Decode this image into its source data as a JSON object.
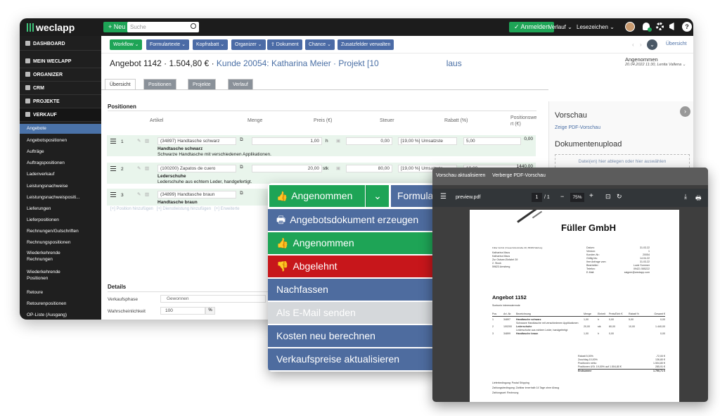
{
  "topbar": {
    "brand": "weclapp",
    "new_label": "+ Neu",
    "search_placeholder": "Suche",
    "login_label": "✓ Anmelden",
    "history_label": "Verlauf ⌄",
    "bookmarks_label": "Lesezeichen ⌄",
    "help_label": "?"
  },
  "sidebar": {
    "sections": [
      {
        "label": "DASHBOARD"
      },
      {
        "label": "MEIN WECLAPP"
      },
      {
        "label": "ORGANIZER"
      },
      {
        "label": "CRM"
      },
      {
        "label": "PROJEKTE"
      },
      {
        "label": "VERKAUF"
      }
    ],
    "items": [
      {
        "label": "Angebote"
      },
      {
        "label": "Angebotspositionen"
      },
      {
        "label": "Aufträge"
      },
      {
        "label": "Auftragspositionen"
      },
      {
        "label": "Ladenverkauf"
      },
      {
        "label": "Leistungsnachweise"
      },
      {
        "label": "Leistungsnachweispositi..."
      },
      {
        "label": "Lieferungen"
      },
      {
        "label": "Lieferpositionen"
      },
      {
        "label": "Rechnungen/Gutschriften"
      },
      {
        "label": "Rechnungspositionen"
      },
      {
        "label": "Wiederkehrende"
      },
      {
        "label": "Rechnungen"
      },
      {
        "label": "Wiederkehrende"
      },
      {
        "label": "Positionen"
      },
      {
        "label": "Retoure"
      },
      {
        "label": "Retourenpositionen"
      },
      {
        "label": "OP-Liste (Ausgang)"
      }
    ]
  },
  "toolbar": {
    "buttons": [
      "Workflow ⌄",
      "Formulartexte ⌄",
      "Kopfrabatt ⌄",
      "Organizer ⌄",
      "⇪ Dokument",
      "Chance ⌄",
      "Zusatzfelder verwalten"
    ],
    "overview_link": "Übersicht"
  },
  "header": {
    "title": "Angebot 1142 · 1.504,80 € · ",
    "customer": "Kunde 20054: Katharina Meier · Projekt [10",
    "customer_tail": "laus",
    "status": "Angenommen",
    "status_meta": "20.04.2022 11:30, Lenita Vallena ⌄"
  },
  "tabs": [
    {
      "label": "Übersicht"
    },
    {
      "label": "Positionen (3)"
    },
    {
      "label": "Projekte (1)"
    },
    {
      "label": "Verlauf"
    }
  ],
  "positions": {
    "heading": "Positionen",
    "columns": {
      "article": "Artikel",
      "qty": "Menge",
      "price": "Preis (€)",
      "tax": "Steuer",
      "discount": "Rabatt (%)",
      "value_1": "Positionswe",
      "value_2": "rt (€)"
    },
    "rows": [
      {
        "num": "1",
        "article": "(34897) Handtasche schwarz",
        "qty": "1,00",
        "unit": "h",
        "price": "0,00",
        "tax": "[19,00 %] Umsatzste",
        "discount": "5,00",
        "value": "0,00",
        "name": "Handtasche schwarz",
        "desc": "Schwarze Handtasche mit verschiedenen Applikationen."
      },
      {
        "num": "2",
        "article": "(100200) Zapatos de cuero",
        "qty": "20,00",
        "unit": "stk",
        "price": "80,00",
        "tax": "[19,00 %] Umsatzste",
        "discount": "10,00",
        "value": "1440,00",
        "name": "Lederschuhe",
        "desc": "Lederschuhe aus echtem Leder, handgefertigt."
      },
      {
        "num": "3",
        "article": "(34899) Handtasche braun",
        "qty": "",
        "unit": "",
        "price": "",
        "tax": "",
        "discount": "",
        "value": "",
        "name": "Handtasche braun",
        "desc": ""
      }
    ],
    "add_links": "[+] Position hinzufügen   [+] Dienstleistung hinzufügen   [+] Erweiterte"
  },
  "details": {
    "heading": "Details",
    "phase_label": "Verkaufsphase",
    "phase_value": "Gewonnen",
    "prob_label": "Wahrscheinlichkeit",
    "prob_value": "100",
    "prob_unit": "%"
  },
  "preview": {
    "heading": "Vorschau",
    "show_pdf": "Zeige PDF-Vorschau",
    "upload_heading": "Dokumentenupload",
    "upload_hint": "Datei(en) hier ablegen oder hier auswählen"
  },
  "dropdown": {
    "top_selected": "Angenommen",
    "top_form": "Formula",
    "items": [
      {
        "label": "Angebotsdokument erzeugen",
        "color": "#4e6c9f",
        "icon": "printer-icon"
      },
      {
        "label": "Angenommen",
        "color": "#1ea456",
        "icon": "thumbs-up-icon"
      },
      {
        "label": "Abgelehnt",
        "color": "#c7161b",
        "icon": "thumbs-down-icon"
      },
      {
        "label": "Nachfassen",
        "color": "#4e6c9f",
        "icon": ""
      },
      {
        "label": "Als E-Mail senden",
        "color": "#d5d8db",
        "icon": ""
      },
      {
        "label": "Kosten neu berechnen",
        "color": "#4e6c9f",
        "icon": ""
      },
      {
        "label": "Verkaufspreise aktualisieren",
        "color": "#4e6c9f",
        "icon": ""
      }
    ]
  },
  "pdf": {
    "toolbar_update": "Vorschau aktualisieren",
    "toolbar_hide": "Verberge PDF-Vorschau",
    "filename": "preview.pdf",
    "page": "1",
    "page_total": "/ 1",
    "zoom": "75%",
    "company": "Füller GmbH",
    "sender_line": "Füller GmbH | Frauenhoferstraße 29 | 86399 Marburg",
    "address": [
      "Katharina Maus",
      "Katharina Maus",
      "Zur Ostsee-Einfahrt 39",
      "2. Stock",
      "59823 Arnsberg"
    ],
    "meta": [
      {
        "k": "Datum:",
        "v": "31.03.22"
      },
      {
        "k": "Version:",
        "v": "1"
      },
      {
        "k": "Kunden-Nr.:",
        "v": "20054"
      },
      {
        "k": "Gültig bis:",
        "v": "14.04.22"
      },
      {
        "k": "Ihre Anfrage vom:",
        "v": "31.03.22"
      },
      {
        "k": "Bearbeiter:",
        "v": "Lucie Sommer"
      },
      {
        "k": "Telefon:",
        "v": "09421 555222"
      },
      {
        "k": "E-Mail:",
        "v": "ssigner@weclapp.com"
      }
    ],
    "doc_title": "Angebot 1152",
    "intro": "Sunkurtz interessierende",
    "table_head": [
      "Pos",
      "Art.-Nr.",
      "Bezeichnung",
      "Menge",
      "Einheit",
      "Preis/Einh €",
      "Rabatt %",
      "Gesamt €"
    ],
    "table_rows": [
      [
        "1",
        "34897",
        "Handtasche schwarz",
        "1,00",
        "h",
        "0,00",
        "5,00",
        "0,00"
      ],
      [
        "",
        "",
        "Schwarze Handtasche mit verschiedenen Applikationen",
        "",
        "",
        "",
        "",
        ""
      ],
      [
        "2",
        "100200",
        "Lederschuhe",
        "20,00",
        "stk",
        "80,00",
        "10,00",
        "1.440,00"
      ],
      [
        "",
        "",
        "Lederschuhe aus echtem Leder, handgefertigt",
        "",
        "",
        "",
        "",
        ""
      ],
      [
        "3",
        "34899",
        "Handtasche braun",
        "1,00",
        "h",
        "0,00",
        "",
        "0,00"
      ]
    ],
    "totals": [
      {
        "k": "Rabatt 5,00%",
        "v": "-72,00 €"
      },
      {
        "k": "Zuschlag 10,00%",
        "v": "136,80 €"
      },
      {
        "k": "Positionen netto:",
        "v": "1.504,80 €"
      },
      {
        "k": "Positionen USt. 19,00% auf 1.504,80 €",
        "v": "285,91 €"
      },
      {
        "k": "Endsumme",
        "v": "1.790,71 €"
      }
    ],
    "footer": [
      "Lieferbedingung: Postal Shipping",
      "Zahlungsbedingung: Zahlbar innerhalb 14 Tage ohne Abzug",
      "Zahlungsart: Rechnung"
    ]
  }
}
